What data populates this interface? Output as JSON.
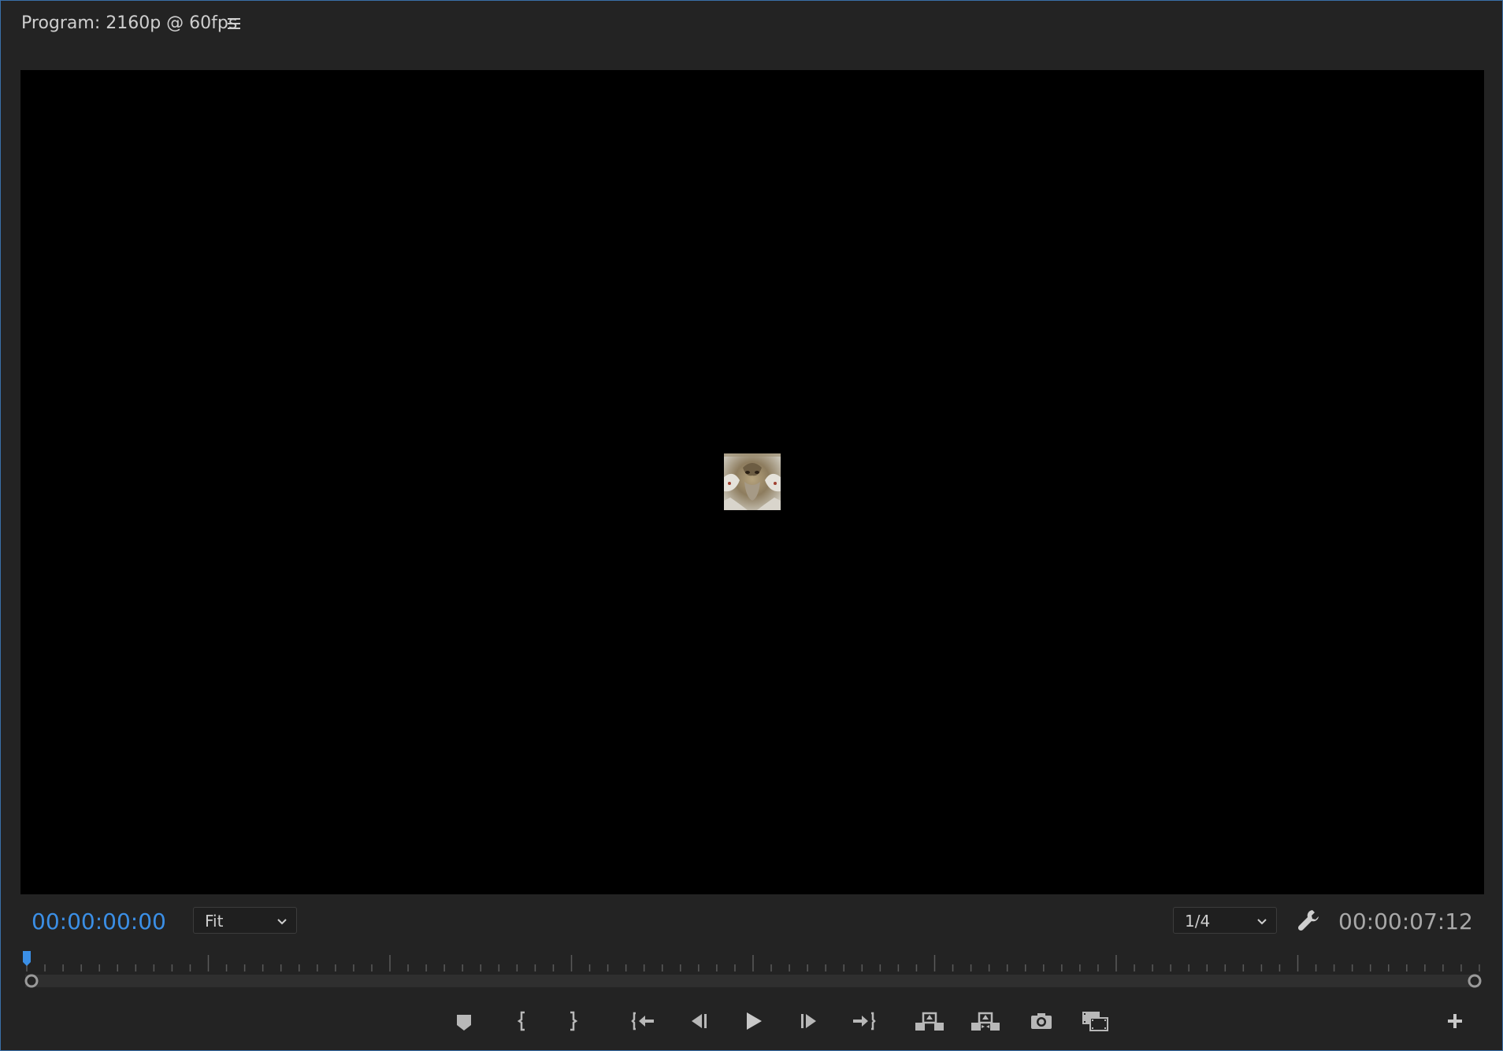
{
  "panel": {
    "title": "Program: 2160p @ 60fps",
    "menu_icon": "hamburger-menu-icon"
  },
  "viewer": {
    "background": "#000000"
  },
  "controls": {
    "current_timecode": "00:00:00:00",
    "zoom": {
      "value": "Fit"
    },
    "resolution": {
      "value": "1/4"
    },
    "settings_icon": "wrench-icon",
    "duration_timecode": "00:00:07:12"
  },
  "timeline": {
    "playhead_fraction": 0.0
  },
  "transport": {
    "buttons": [
      {
        "name": "add-marker-button",
        "icon": "marker-icon"
      },
      {
        "name": "mark-in-button",
        "icon": "mark-in-icon"
      },
      {
        "name": "mark-out-button",
        "icon": "mark-out-icon"
      },
      {
        "name": "go-to-in-button",
        "icon": "go-to-in-icon"
      },
      {
        "name": "step-back-button",
        "icon": "step-back-icon"
      },
      {
        "name": "play-button",
        "icon": "play-icon"
      },
      {
        "name": "step-forward-button",
        "icon": "step-forward-icon"
      },
      {
        "name": "go-to-out-button",
        "icon": "go-to-out-icon"
      },
      {
        "name": "lift-button",
        "icon": "lift-icon"
      },
      {
        "name": "extract-button",
        "icon": "extract-icon"
      },
      {
        "name": "export-frame-button",
        "icon": "camera-icon"
      },
      {
        "name": "comparison-view-button",
        "icon": "comparison-view-icon"
      },
      {
        "name": "button-editor-button",
        "icon": "plus-icon"
      }
    ]
  },
  "colors": {
    "panel_bg": "#232323",
    "accent_blue": "#3b8fe6",
    "text": "#cfcfcf",
    "icon": "#b8b8b8"
  }
}
